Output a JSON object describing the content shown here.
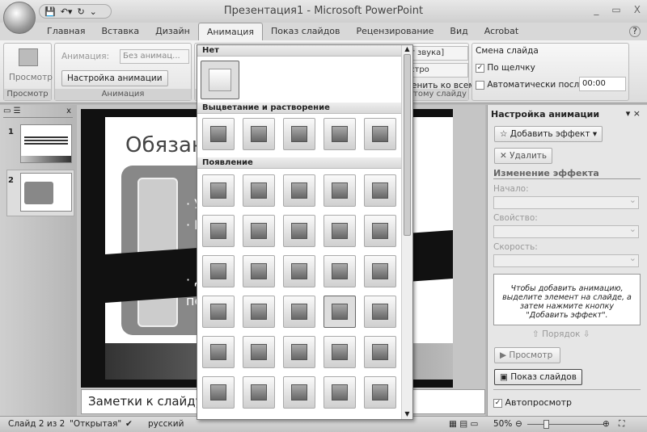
{
  "window": {
    "title": "Презентация1 - Microsoft PowerPoint",
    "min": "_",
    "max": "▭",
    "close": "X",
    "help": "?"
  },
  "tabs": [
    "Главная",
    "Вставка",
    "Дизайн",
    "Анимация",
    "Показ слайдов",
    "Рецензирование",
    "Вид",
    "Acrobat"
  ],
  "ribbon": {
    "preview_btn": "Просмотр",
    "preview_group": "Просмотр",
    "animation_label": "Анимация:",
    "animation_value": "Без анимац...",
    "custom_anim": "Настройка анимации",
    "animation_group": "Анимация",
    "sound_value": "т звука]",
    "speed_value": "стро",
    "apply_all": "енить ко всем",
    "transition_group": "тому слайду",
    "slide_change": "Смена слайда",
    "on_click": "По щелчку",
    "auto_after": "Автоматически после:",
    "auto_time": "00:00"
  },
  "gallery": {
    "none": "Нет",
    "fade": "Выцветание и растворение",
    "appear": "Появление"
  },
  "thumbs": [
    "1",
    "2"
  ],
  "slide": {
    "title": "Обязан",
    "bullets": [
      "· У",
      "· П",
      "· Д",
      "пе"
    ]
  },
  "notes": "Заметки к слайду",
  "pane": {
    "title": "Настройка анимации",
    "add_effect": "Добавить эффект",
    "remove": "Удалить",
    "change": "Изменение эффекта",
    "start": "Начало:",
    "property": "Свойство:",
    "speed": "Скорость:",
    "hint": "Чтобы добавить анимацию, выделите элемент на слайде, а затем нажмите кнопку \"Добавить эффект\".",
    "order": "Порядок",
    "play": "Просмотр",
    "slideshow": "Показ слайдов",
    "autopreview": "Автопросмотр"
  },
  "status": {
    "slide": "Слайд 2 из 2",
    "theme": "\"Открытая\"",
    "lang": "русский",
    "zoom": "50%"
  }
}
